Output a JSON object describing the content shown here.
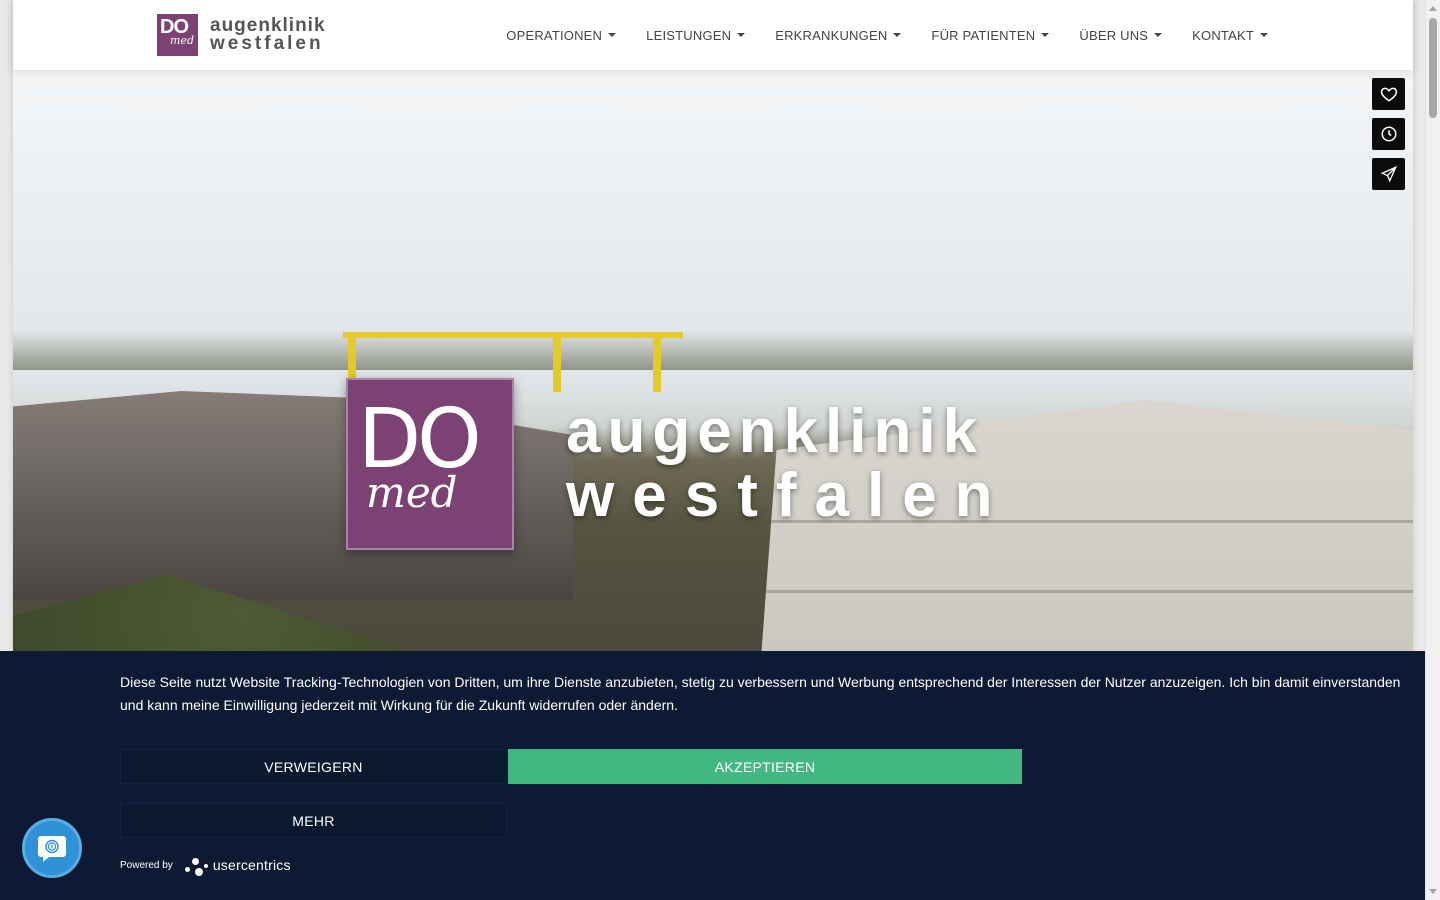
{
  "header": {
    "logo": {
      "mark_top": "DO",
      "mark_bottom": "med",
      "line1": "augenklinik",
      "line2": "westfalen"
    },
    "nav": [
      {
        "label": "OPERATIONEN"
      },
      {
        "label": "LEISTUNGEN"
      },
      {
        "label": "ERKRANKUNGEN"
      },
      {
        "label": "FÜR PATIENTEN"
      },
      {
        "label": "ÜBER UNS"
      },
      {
        "label": "KONTAKT"
      }
    ]
  },
  "hero": {
    "logo": {
      "mark_top": "DO",
      "mark_bottom": "med",
      "line1": "augenklinik",
      "line2": "westfalen"
    }
  },
  "side_tools": [
    "heart-icon",
    "clock-icon",
    "send-icon"
  ],
  "consent": {
    "text": "Diese Seite nutzt Website Tracking-Technologien von Dritten, um ihre Dienste anzubieten, stetig zu verbessern und Werbung entsprechend der Interessen der Nutzer anzuzeigen. Ich bin damit einverstanden und kann meine Einwilligung jederzeit mit Wirkung für die Zukunft widerrufen oder ändern.",
    "deny_label": "VERWEIGERN",
    "accept_label": "AKZEPTIEREN",
    "more_label": "MEHR",
    "powered_by": "Powered by",
    "brand": "usercentrics"
  },
  "colors": {
    "brand_purple": "#7d4274",
    "consent_bg": "#0c1b33",
    "accept_green": "#42b782",
    "chat_blue": "#2f91d6"
  }
}
